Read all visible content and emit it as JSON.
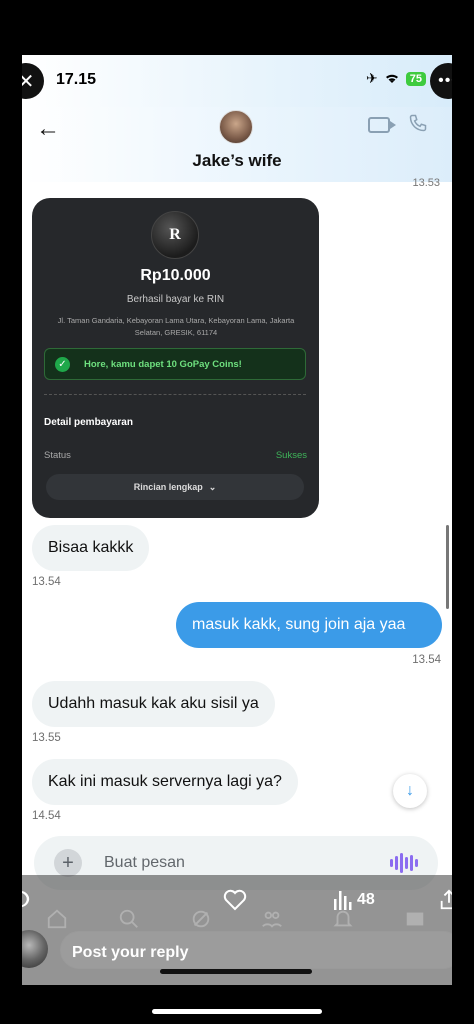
{
  "status_bar": {
    "time": "17.15",
    "battery": "75",
    "close_icon": "close-icon",
    "more_icon": "more-icon"
  },
  "chat_header": {
    "contact_name": "Jake’s wife",
    "top_message_time": "13.53"
  },
  "payment_card": {
    "merchant_initial": "R",
    "amount": "Rp10.000",
    "paid_to": "Berhasil bayar ke RIN",
    "address": "Jl. Taman Gandaria, Kebayoran Lama Utara, Kebayoran Lama, Jakarta Selatan, GRESIK, 61174",
    "coins_message": "Hore, kamu dapet 10 GoPay Coins!",
    "detail_title": "Detail pembayaran",
    "status_label": "Status",
    "status_value": "Sukses",
    "details_button": "Rincian lengkap",
    "status_color": "#3fb45a"
  },
  "messages": [
    {
      "text": "Bisaa kakkk",
      "time": "13.54",
      "direction": "incoming"
    },
    {
      "text": "masuk kakk, sung join aja yaa",
      "time": "13.54",
      "direction": "outgoing"
    },
    {
      "text": "Udahh masuk kak aku sisil ya",
      "time": "13.55",
      "direction": "incoming"
    },
    {
      "text": "Kak ini masuk servernya lagi ya?",
      "time": "14.54",
      "direction": "incoming"
    }
  ],
  "composer": {
    "placeholder": "Buat pesan"
  },
  "tweet_overlay": {
    "views": "48",
    "reply_placeholder": "Post your reply"
  },
  "colors": {
    "outgoing_bubble": "#3b9be8",
    "incoming_bubble": "#eff3f4",
    "card_background": "#26282b"
  }
}
